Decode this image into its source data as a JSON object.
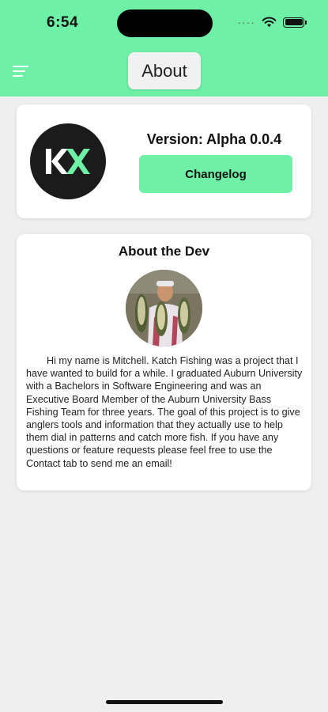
{
  "status_bar": {
    "time": "6:54",
    "signal": "····"
  },
  "header": {
    "title": "About",
    "menu_icon": "hamburger-menu-icon"
  },
  "version_card": {
    "logo_icon": "katch-logo-icon",
    "logo_text": "KX",
    "version_label": "Version: Alpha 0.0.4",
    "changelog_button": "Changelog"
  },
  "dev_card": {
    "title": "About the Dev",
    "avatar_icon": "developer-photo-avatar",
    "bio": "Hi my name is Mitchell. Katch Fishing was a project that I have wanted to build for a while. I graduated Auburn University with a Bachelors in Software Engineering and was an Executive Board Member of the Auburn University Bass Fishing Team for three years. The goal of this project is to give anglers tools and information that they actually use to help them dial in patterns and catch more fish. If you have any questions or feature requests please feel free to use the Contact tab to send me an email!"
  },
  "colors": {
    "accent": "#6ef0a6",
    "background": "#efefef",
    "logo_bg": "#1b1b1b"
  }
}
